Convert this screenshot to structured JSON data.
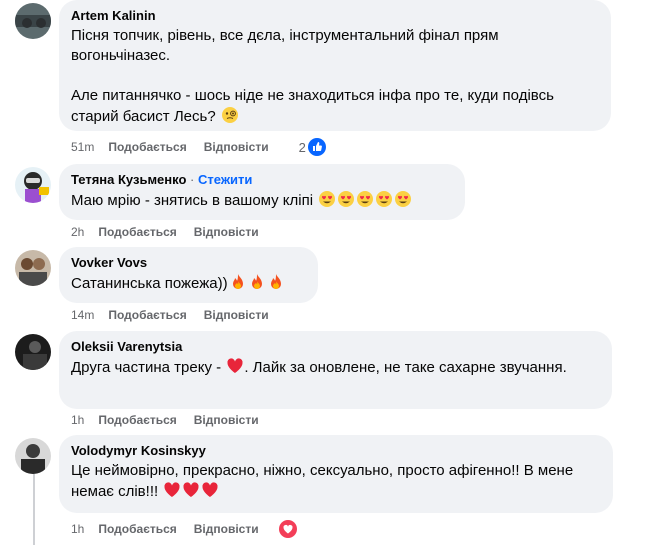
{
  "comments": [
    {
      "author": "Artem Kalinin",
      "text1": "Пісня топчик, рівень, все дєла, інструментальний фінал прям вогоньчіназес.",
      "text2": "Але питаннячко - шось ніде не знаходиться інфа про те, куди подівсь старий басист Лесь?",
      "time": "51m",
      "like": "Подобається",
      "reply": "Відповісти",
      "reaction_count": "2",
      "reaction_type": "like-icon"
    },
    {
      "author": "Тетяна Кузьменко",
      "follow_sep": "·",
      "follow": "Стежити",
      "text": "Маю мрію - знятись в вашому кліпі",
      "time": "2h",
      "like": "Подобається",
      "reply": "Відповісти"
    },
    {
      "author": "Vovker Vovs",
      "text": "Сатанинська пожежа))",
      "time": "14m",
      "like": "Подобається",
      "reply": "Відповісти"
    },
    {
      "author": "Oleksii Varenytsia",
      "text": "Друга частина треку - ❤. Лайк за оновлене, не таке сахарне звучання.",
      "text_before": "Друга частина треку - ",
      "text_after": ". Лайк за оновлене, не таке сахарне звучання.",
      "time": "1h",
      "like": "Подобається",
      "reply": "Відповісти"
    },
    {
      "author": "Volodymyr Kosinskyy",
      "text": "Це неймовірно, прекрасно, ніжно, сексуально, просто афігенно!! В мене немає слів!!!",
      "time": "1h",
      "like": "Подобається",
      "reply": "Відповісти",
      "reaction_type": "love-icon"
    }
  ],
  "colors": {
    "bubble": "#f0f2f5",
    "meta": "#65676b",
    "follow": "#0866ff",
    "like_blue": "#0866ff",
    "love_red": "#f33e58"
  }
}
